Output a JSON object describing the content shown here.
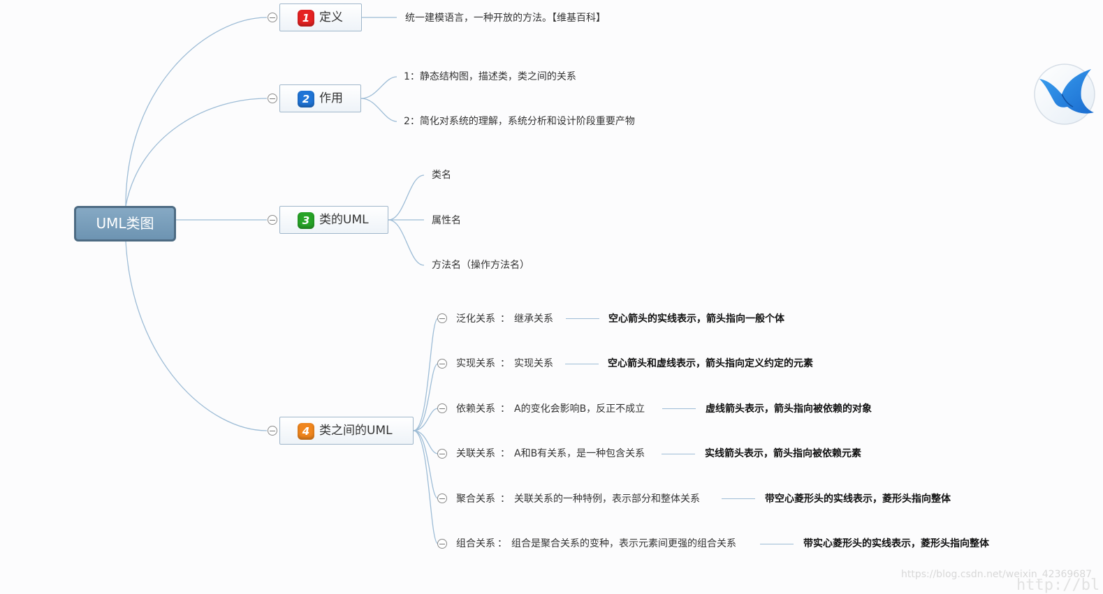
{
  "root": {
    "label": "UML类图"
  },
  "branches": [
    {
      "num": "1",
      "label": "定义",
      "color": "#e52222",
      "children": [
        "统一建模语言，一种开放的方法。【维基百科】"
      ]
    },
    {
      "num": "2",
      "label": "作用",
      "color": "#1f74d6",
      "children": [
        "1：静态结构图，描述类，类之间的关系",
        "2：简化对系统的理解，系统分析和设计阶段重要产物"
      ]
    },
    {
      "num": "3",
      "label": "类的UML",
      "color": "#27a327",
      "children": [
        "类名",
        "属性名",
        "方法名（操作方法名）"
      ]
    },
    {
      "num": "4",
      "label": "类之间的UML",
      "color": "#f0861e",
      "relations": [
        {
          "name": "泛化关系",
          "desc": "继承关系",
          "note": "空心箭头的实线表示，箭头指向一般个体"
        },
        {
          "name": "实现关系",
          "desc": "实现关系",
          "note": "空心箭头和虚线表示，箭头指向定义约定的元素"
        },
        {
          "name": "依赖关系",
          "desc": "A的变化会影响B，反正不成立",
          "note": "虚线箭头表示，箭头指向被依赖的对象"
        },
        {
          "name": "关联关系",
          "desc": "A和B有关系，是一种包含关系",
          "note": "实线箭头表示，箭头指向被依赖元素"
        },
        {
          "name": "聚合关系",
          "desc": "关联关系的一种特例，表示部分和整体关系",
          "note": "带空心菱形头的实线表示，菱形头指向整体"
        },
        {
          "name": "组合关系",
          "desc": "组合是聚合关系的变种，表示元素间更强的组合关系",
          "note": "带实心菱形头的实线表示，菱形头指向整体"
        }
      ],
      "rel_separator": "：",
      "rel_separator_last": "："
    }
  ],
  "watermark": "https://blog.csdn.net/weixin_42369687",
  "watermark_fragment": "http://bl",
  "colors": {
    "connector": "#9dbcd6",
    "root_fill": "#6d94b2",
    "root_border": "#4d6b83"
  },
  "icons": {
    "app_logo": "bird-icon"
  }
}
